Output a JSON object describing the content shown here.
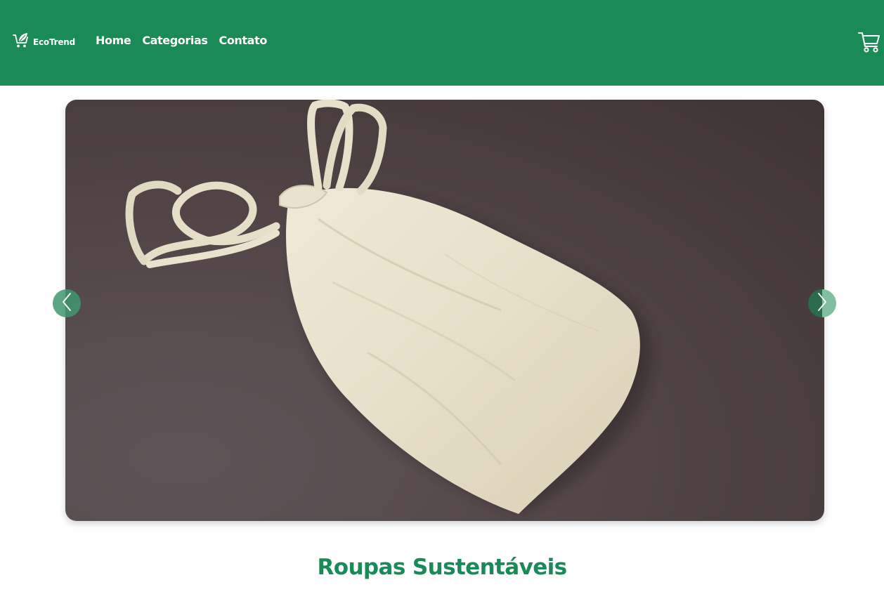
{
  "header": {
    "logo_text": "EcoTrend",
    "logo_icon": "leaf-cart-icon",
    "background_color": "#1a8a56",
    "nav": [
      {
        "label": "Home"
      },
      {
        "label": "Categorias"
      },
      {
        "label": "Contato"
      }
    ],
    "cart_icon": "shopping-cart-icon"
  },
  "carousel": {
    "image_subject": "cotton drawstring bag",
    "prev_icon": "chevron-left-icon",
    "next_icon": "chevron-right-icon"
  },
  "section": {
    "title": "Roupas Sustentáveis",
    "title_color": "#1a8a56"
  }
}
